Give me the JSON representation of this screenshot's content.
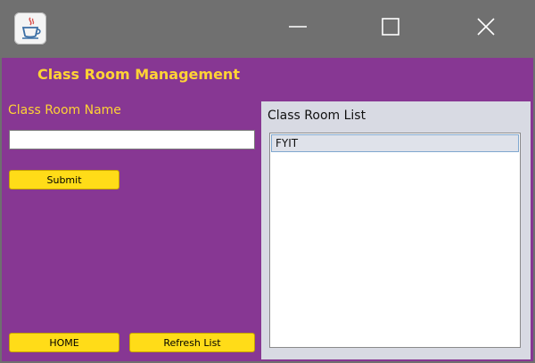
{
  "window": {
    "controls": [
      "minimize-icon",
      "maximize-icon",
      "close-icon"
    ]
  },
  "header": {
    "title": "Class Room Management"
  },
  "form": {
    "name_label": "Class Room Name",
    "name_value": "",
    "submit_label": "Submit"
  },
  "bottom_buttons": {
    "home_label": "HOME",
    "refresh_label": "Refresh List"
  },
  "list_panel": {
    "title": "Class Room List",
    "items": [
      {
        "label": "FYIT",
        "selected": true
      }
    ]
  },
  "colors": {
    "background": "#873793",
    "accent_text": "#ffd335",
    "button": "#ffdc18",
    "titlebar": "#707070"
  }
}
